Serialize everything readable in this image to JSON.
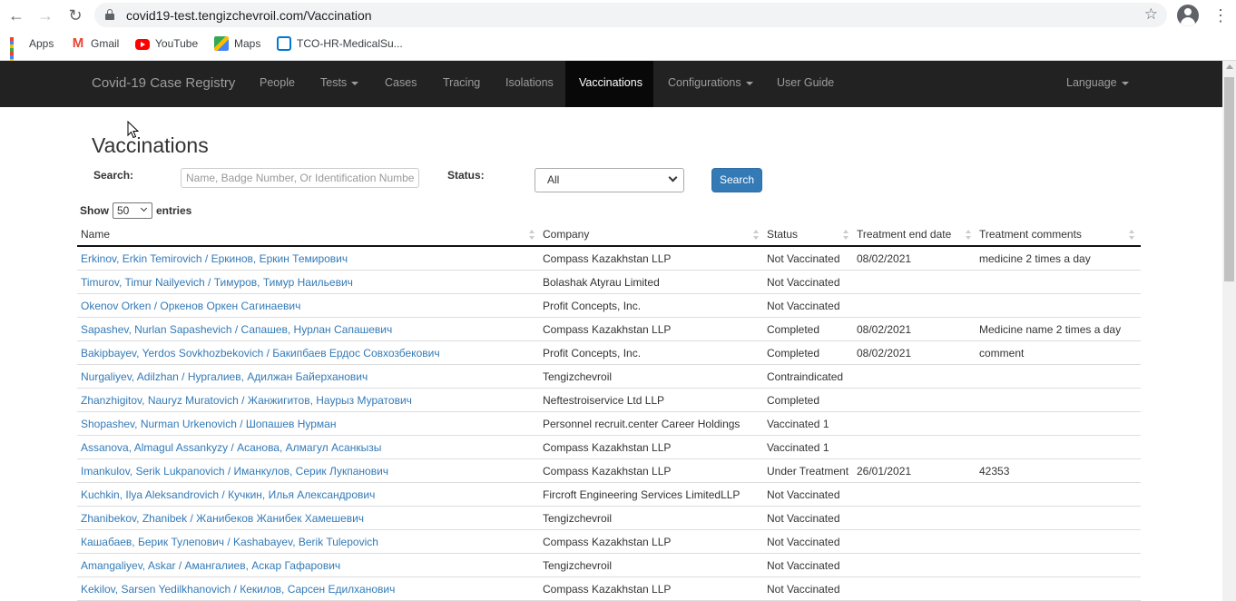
{
  "browser": {
    "url": "covid19-test.tengizchevroil.com/Vaccination",
    "bookmarks": [
      {
        "label": "Apps",
        "icon": "apps-icon"
      },
      {
        "label": "Gmail",
        "icon": "gmail-icon"
      },
      {
        "label": "YouTube",
        "icon": "youtube-icon"
      },
      {
        "label": "Maps",
        "icon": "maps-icon"
      },
      {
        "label": "TCO-HR-MedicalSu...",
        "icon": "tco-icon"
      }
    ]
  },
  "navbar": {
    "brand": "Covid-19 Case Registry",
    "items": [
      {
        "label": "People"
      },
      {
        "label": "Tests"
      },
      {
        "label": "Cases"
      },
      {
        "label": "Tracing"
      },
      {
        "label": "Isolations"
      },
      {
        "label": "Vaccinations"
      },
      {
        "label": "Configurations"
      },
      {
        "label": "User Guide"
      },
      {
        "label": "Language"
      }
    ]
  },
  "page": {
    "title": "Vaccinations",
    "search_label": "Search:",
    "search_placeholder": "Name, Badge Number, Or Identification Number",
    "status_label": "Status:",
    "status_value": "All",
    "search_button": "Search",
    "show_label": "Show",
    "entries_value": "50",
    "entries_label": "entries"
  },
  "table": {
    "columns": [
      "Name",
      "Company",
      "Status",
      "Treatment end date",
      "Treatment comments"
    ],
    "rows": [
      {
        "name": "Erkinov, Erkin Temirovich / Еркинов, Еркин Темирович",
        "company": "Compass Kazakhstan LLP",
        "status": "Not Vaccinated",
        "end": "08/02/2021",
        "comment": "medicine 2 times a day"
      },
      {
        "name": "Timurov, Timur Nailyevich / Тимуров, Тимур Наильевич",
        "company": "Bolashak Atyrau Limited",
        "status": "Not Vaccinated",
        "end": "",
        "comment": ""
      },
      {
        "name": "Okenov Orken / Оркенов Оркен Сагинаевич",
        "company": "Profit Concepts, Inc.",
        "status": "Not Vaccinated",
        "end": "",
        "comment": ""
      },
      {
        "name": "Sapashev, Nurlan Sapashevich / Сапашев, Нурлан Сапашевич",
        "company": "Compass Kazakhstan LLP",
        "status": "Completed",
        "end": "08/02/2021",
        "comment": "Medicine name 2 times a day"
      },
      {
        "name": "Bakipbayev, Yerdos Sovkhozbekovich / Бакипбаев Ердос Совхозбекович",
        "company": "Profit Concepts, Inc.",
        "status": "Completed",
        "end": "08/02/2021",
        "comment": "comment"
      },
      {
        "name": "Nurgaliyev, Adilzhan / Нургалиев, Адилжан Байерханович",
        "company": "Tengizchevroil",
        "status": "Contraindicated",
        "end": "",
        "comment": ""
      },
      {
        "name": "Zhanzhigitov, Nauryz Muratovich / Жанжигитов, Наурыз Муратович",
        "company": "Neftestroiservice Ltd LLP",
        "status": "Completed",
        "end": "",
        "comment": ""
      },
      {
        "name": "Shopashev, Nurman Urkenovich / Шопашев Нурман",
        "company": "Personnel recruit.center Career Holdings",
        "status": "Vaccinated 1",
        "end": "",
        "comment": ""
      },
      {
        "name": "Assanova, Almagul Assankyzy / Асанова, Алмагул Асанкызы",
        "company": "Compass Kazakhstan LLP",
        "status": "Vaccinated 1",
        "end": "",
        "comment": ""
      },
      {
        "name": "Imankulov, Serik Lukpanovich / Иманкулов, Серик Лукпанович",
        "company": "Compass Kazakhstan LLP",
        "status": "Under Treatment",
        "end": "26/01/2021",
        "comment": "42353"
      },
      {
        "name": "Kuchkin, Ilya Aleksandrovich / Кучкин, Илья Александрович",
        "company": "Fircroft Engineering Services LimitedLLP",
        "status": "Not Vaccinated",
        "end": "",
        "comment": ""
      },
      {
        "name": "Zhanibekov, Zhanibek / Жанибеков Жанибек Хамешевич",
        "company": "Tengizchevroil",
        "status": "Not Vaccinated",
        "end": "",
        "comment": ""
      },
      {
        "name": "Кашабаев, Берик Тулепович / Kashabayev, Berik Tulepovich",
        "company": "Compass Kazakhstan LLP",
        "status": "Not Vaccinated",
        "end": "",
        "comment": ""
      },
      {
        "name": "Amangaliyev, Askar / Амангалиев, Аскар Гафарович",
        "company": "Tengizchevroil",
        "status": "Not Vaccinated",
        "end": "",
        "comment": ""
      },
      {
        "name": "Kekilov, Sarsen Yedilkhanovich / Кекилов, Сарсен Едилханович",
        "company": "Compass Kazakhstan LLP",
        "status": "Not Vaccinated",
        "end": "",
        "comment": ""
      }
    ]
  }
}
